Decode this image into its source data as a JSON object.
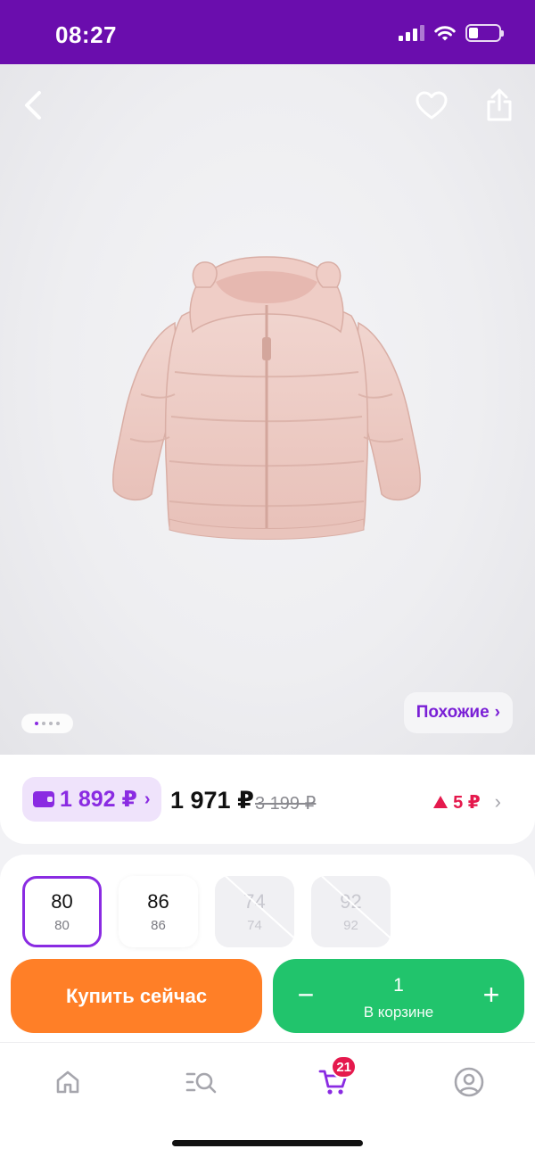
{
  "status_bar": {
    "time": "08:27",
    "battery_level": 0.3
  },
  "product": {
    "image_icon": "pink-puffer-jacket-image",
    "carousel": {
      "total": 4,
      "active_index": 0
    },
    "similar_label": "Похожие",
    "similar_arrow": "›"
  },
  "price": {
    "wallet_price": "1 892 ₽",
    "wallet_arrow": "›",
    "current": "1 971 ₽",
    "old": "3 199 ₽",
    "change": "5 ₽",
    "change_direction": "up",
    "change_arrow": "›"
  },
  "sizes": [
    {
      "label": "80",
      "sub": "80",
      "state": "selected"
    },
    {
      "label": "86",
      "sub": "86",
      "state": "available"
    },
    {
      "label": "74",
      "sub": "74",
      "state": "unavailable"
    },
    {
      "label": "92",
      "sub": "92",
      "state": "unavailable"
    }
  ],
  "actions": {
    "buy_now": "Купить сейчас",
    "minus": "−",
    "plus": "+",
    "quantity": "1",
    "in_cart": "В корзине"
  },
  "nav": {
    "items": [
      "home-icon",
      "catalog-search-icon",
      "cart-icon",
      "profile-icon"
    ],
    "cart_badge": "21",
    "active": "cart"
  },
  "colors": {
    "brand_purple": "#6a0dad",
    "accent_purple": "#8a2be2",
    "buy_orange": "#ff7f27",
    "cart_green": "#21c46c",
    "alert_red": "#e5194d"
  }
}
